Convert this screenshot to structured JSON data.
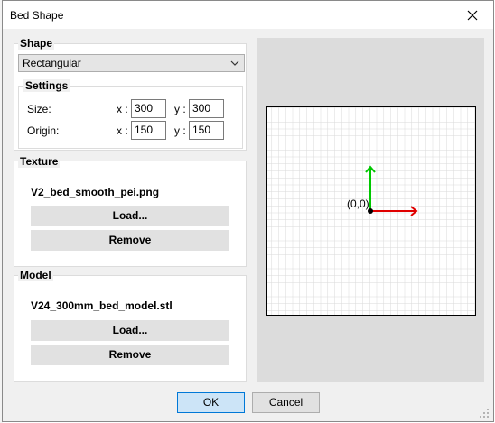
{
  "dialog": {
    "title": "Bed Shape"
  },
  "shape": {
    "label": "Shape",
    "selected": "Rectangular",
    "settings": {
      "label": "Settings",
      "size_label": "Size:",
      "origin_label": "Origin:",
      "x_label": "x :",
      "y_label": "y :",
      "size_x": "300",
      "size_y": "300",
      "origin_x": "150",
      "origin_y": "150"
    }
  },
  "texture": {
    "label": "Texture",
    "filename": "V2_bed_smooth_pei.png",
    "load": "Load...",
    "remove": "Remove"
  },
  "model": {
    "label": "Model",
    "filename": "V24_300mm_bed_model.stl",
    "load": "Load...",
    "remove": "Remove"
  },
  "preview": {
    "origin_label": "(0,0)",
    "x_axis_color": "#e00000",
    "y_axis_color": "#00c800"
  },
  "footer": {
    "ok": "OK",
    "cancel": "Cancel"
  }
}
